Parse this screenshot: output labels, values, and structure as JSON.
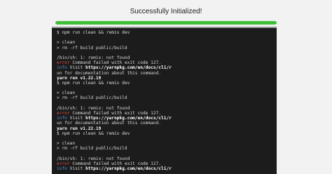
{
  "header": {
    "title": "Successfully Initialized!"
  },
  "progress": {
    "value": 1.0,
    "fill_color": "#3fbf38",
    "track_color": "#d6d6d6"
  },
  "terminal": {
    "lines": [
      {
        "kind": "plain",
        "text": "$ npm run clean && remix dev"
      },
      {
        "kind": "blank"
      },
      {
        "kind": "plain",
        "text": "> clean"
      },
      {
        "kind": "plain",
        "text": "> rm -rf build public/build"
      },
      {
        "kind": "blank"
      },
      {
        "kind": "plain",
        "text": "/bin/sh: 1: remix: not found"
      },
      {
        "kind": "tagged",
        "tag": "error",
        "text": " Command failed with exit code 127."
      },
      {
        "kind": "info",
        "tag": "info",
        "pre": " Visit ",
        "link": "https://yarnpkg.com/en/docs/cli/r"
      },
      {
        "kind": "plain",
        "text": "un for documentation about this command."
      },
      {
        "kind": "bold",
        "text": "yarn run v1.22.19"
      },
      {
        "kind": "plain",
        "text": "$ npm run clean && remix dev"
      },
      {
        "kind": "blank"
      },
      {
        "kind": "plain",
        "text": "> clean"
      },
      {
        "kind": "plain",
        "text": "> rm -rf build public/build"
      },
      {
        "kind": "blank"
      },
      {
        "kind": "plain",
        "text": "/bin/sh: 1: remix: not found"
      },
      {
        "kind": "tagged",
        "tag": "error",
        "text": " Command failed with exit code 127."
      },
      {
        "kind": "info",
        "tag": "info",
        "pre": " Visit ",
        "link": "https://yarnpkg.com/en/docs/cli/r"
      },
      {
        "kind": "plain",
        "text": "un for documentation about this command."
      },
      {
        "kind": "bold",
        "text": "yarn run v1.22.19"
      },
      {
        "kind": "plain",
        "text": "$ npm run clean && remix dev"
      },
      {
        "kind": "blank"
      },
      {
        "kind": "plain",
        "text": "> clean"
      },
      {
        "kind": "plain",
        "text": "> rm -rf build public/build"
      },
      {
        "kind": "blank"
      },
      {
        "kind": "plain",
        "text": "/bin/sh: 1: remix: not found"
      },
      {
        "kind": "tagged",
        "tag": "error",
        "text": " Command failed with exit code 127."
      },
      {
        "kind": "info",
        "tag": "info",
        "pre": " Visit ",
        "link": "https://yarnpkg.com/en/docs/cli/r"
      }
    ]
  }
}
